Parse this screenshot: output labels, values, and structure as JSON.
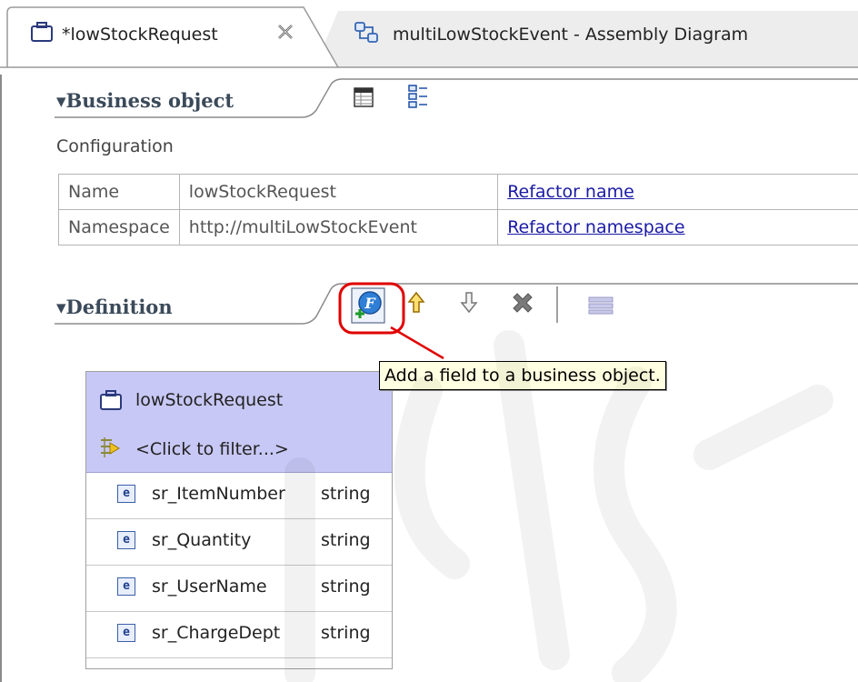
{
  "tabs": [
    {
      "label": "*lowStockRequest",
      "active": true,
      "icon": "business-object-icon",
      "closable": true
    },
    {
      "label": "multiLowStockEvent - Assembly Diagram",
      "active": false,
      "icon": "assembly-diagram-icon"
    }
  ],
  "business_object_section": {
    "title": "Business object",
    "toolbar": [
      "table-view-icon",
      "tree-view-icon"
    ],
    "configuration_label": "Configuration",
    "rows": [
      {
        "label": "Name",
        "value": "lowStockRequest",
        "link": "Refactor name"
      },
      {
        "label": "Namespace",
        "value": "http://multiLowStockEvent",
        "link": "Refactor namespace"
      }
    ]
  },
  "definition_section": {
    "title": "Definition",
    "toolbar": [
      "add-field-icon",
      "move-up-icon",
      "move-down-icon",
      "delete-icon",
      "separator",
      "properties-icon"
    ],
    "tooltip": "Add a field to a business object.",
    "highlight_color": "#e00000"
  },
  "business_object": {
    "name": "lowStockRequest",
    "filter_placeholder": "<Click to filter...>",
    "fields": [
      {
        "icon": "e",
        "name": "sr_ItemNumber",
        "type": "string"
      },
      {
        "icon": "e",
        "name": "sr_Quantity",
        "type": "string"
      },
      {
        "icon": "e",
        "name": "sr_UserName",
        "type": "string"
      },
      {
        "icon": "e",
        "name": "sr_ChargeDept",
        "type": "string"
      }
    ],
    "header_color": "#c8c8f6"
  }
}
